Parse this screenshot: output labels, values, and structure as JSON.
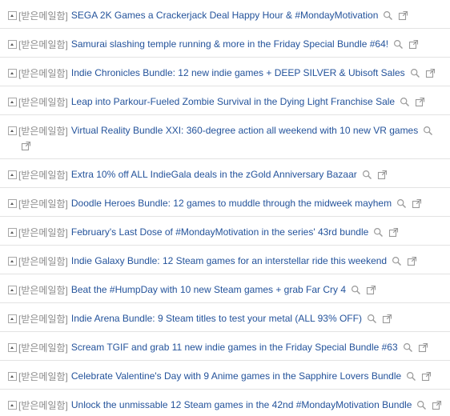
{
  "folder_label": "[받은메일함]",
  "mails": [
    {
      "subject": "SEGA 2K Games a Crackerjack Deal Happy Hour & #MondayMotivation"
    },
    {
      "subject": "Samurai slashing temple running & more in the Friday Special Bundle #64!"
    },
    {
      "subject": "Indie Chronicles Bundle: 12 new indie games + DEEP SILVER & Ubisoft Sales"
    },
    {
      "subject": "Leap into Parkour-Fueled Zombie Survival in the Dying Light Franchise Sale"
    },
    {
      "subject": "Virtual Reality Bundle XXI: 360-degree action all weekend with 10 new VR games"
    },
    {
      "subject": "Extra 10% off ALL IndieGala deals in the zGold Anniversary Bazaar"
    },
    {
      "subject": "Doodle Heroes Bundle: 12 games to muddle through the midweek mayhem"
    },
    {
      "subject": "February's Last Dose of #MondayMotivation in the series' 43rd bundle"
    },
    {
      "subject": "Indie Galaxy Bundle: 12 Steam games for an interstellar ride this weekend"
    },
    {
      "subject": "Beat the #HumpDay with 10 new Steam games + grab Far Cry 4"
    },
    {
      "subject": "Indie Arena Bundle: 9 Steam titles to test your metal (ALL 93% OFF)"
    },
    {
      "subject": "Scream TGIF and grab 11 new indie games in the Friday Special Bundle #63"
    },
    {
      "subject": "Celebrate Valentine's Day with 9 Anime games in the Sapphire Lovers Bundle"
    },
    {
      "subject": "Unlock the unmissable 12 Steam games in the 42nd #MondayMotivation Bundle"
    }
  ],
  "icons": {
    "expand": "expand-icon",
    "search": "search-icon",
    "open_new_window": "new-window-icon"
  },
  "colors": {
    "link": "#24539b",
    "folder": "#8a8a8a",
    "icon": "#9a9a9a",
    "divider": "#e3e3e3"
  }
}
